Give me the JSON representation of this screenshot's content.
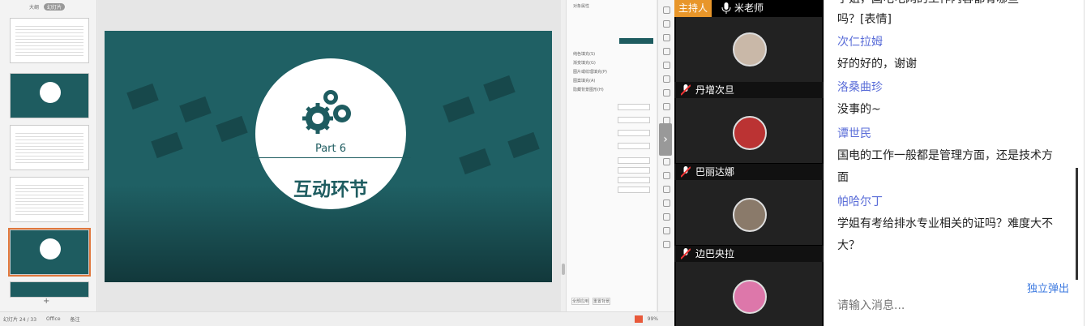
{
  "thumbs": {
    "tab_outline": "大纲",
    "tab_slides": "幻灯片",
    "add": "+"
  },
  "slide": {
    "part": "Part 6",
    "title": "互动环节"
  },
  "props": {
    "header": "对象属性",
    "options": [
      "纯色填充(S)",
      "渐变填充(G)",
      "图片或纹理填充(P)",
      "图案填充(A)",
      "隐藏背景图形(H)"
    ],
    "buttons": [
      "全部应用",
      "重置背景"
    ]
  },
  "status": {
    "slide_info": "幻灯片 24 / 33",
    "theme": "Office",
    "notes": "备注",
    "zoom": "99%"
  },
  "participants": {
    "host_role": "主持人",
    "host_name": "米老师",
    "list": [
      {
        "name": "丹增次旦"
      },
      {
        "name": "巴丽达娜"
      },
      {
        "name": "边巴央拉"
      }
    ]
  },
  "chat": {
    "messages": [
      {
        "type": "text",
        "text": "学姐，国电电网的工作内容都有哪些"
      },
      {
        "type": "text",
        "text": "吗？[表情]"
      },
      {
        "type": "user",
        "text": "次仁拉姆"
      },
      {
        "type": "text",
        "text": "好的好的，谢谢"
      },
      {
        "type": "user",
        "text": "洛桑曲珍"
      },
      {
        "type": "text",
        "text": "没事的~"
      },
      {
        "type": "user",
        "text": "谭世民"
      },
      {
        "type": "text",
        "text": "国电的工作一般都是管理方面，还是技术方"
      },
      {
        "type": "text",
        "text": "面"
      },
      {
        "type": "user",
        "text": "帕哈尔丁"
      },
      {
        "type": "text",
        "text": "学姐有考给排水专业相关的证吗？难度大不"
      },
      {
        "type": "text",
        "text": "大？"
      }
    ],
    "popout": "独立弹出",
    "input_placeholder": "请输入消息..."
  },
  "colors": {
    "slide_teal": "#1f6064",
    "host_badge": "#e8962a",
    "chat_user": "#5a6dd8",
    "link": "#3d7ae0"
  }
}
